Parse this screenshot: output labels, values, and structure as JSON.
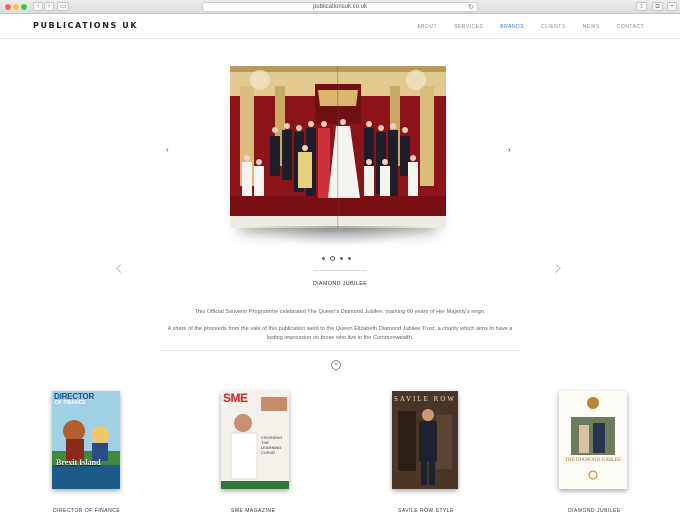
{
  "browser": {
    "url": "publicationsuk.co.uk",
    "back_glyph": "‹",
    "forward_glyph": "›",
    "reload_glyph": "↻"
  },
  "header": {
    "logo": "PUBLICATIONS UK",
    "nav": [
      {
        "label": "ABOUT",
        "active": false
      },
      {
        "label": "SERVICES",
        "active": false
      },
      {
        "label": "BRANDS",
        "active": true
      },
      {
        "label": "CLIENTS",
        "active": false
      },
      {
        "label": "NEWS",
        "active": false
      },
      {
        "label": "CONTACT",
        "active": false
      }
    ]
  },
  "slider": {
    "title": "DIAMOND JUBILEE",
    "description_1": "This Official Souvenir Programme celebrated The Queen's Diamond Jubilee, marking 60 years of Her Majesty's reign.",
    "description_2": "A share of the proceeds from the sale of this publication went to the Queen Elizabeth Diamond Jubilee Trust, a charity which aims to have a lasting impression on those who live in the Commonwealth.",
    "dots": 4,
    "current_dot": 1,
    "prev_glyph": "‹",
    "next_glyph": "›",
    "close_glyph": "✕"
  },
  "covers": [
    {
      "label": "DIRECTOR OF FINANCE",
      "masthead": "DIRECTOR",
      "masthead_sub": "OF FINANCE",
      "headline": "Brexit Island"
    },
    {
      "label": "SME MAGAZINE",
      "masthead": "SME",
      "headline": "CROSSING THE LEARNING CURVE"
    },
    {
      "label": "SAVILE ROW STYLE",
      "masthead": "SAVILE ROW"
    },
    {
      "label": "DIAMOND JUBILEE",
      "masthead": "THE DIAMOND JUBILEE"
    }
  ],
  "colors": {
    "accent": "#3c82c7",
    "background": "#ffffff"
  }
}
